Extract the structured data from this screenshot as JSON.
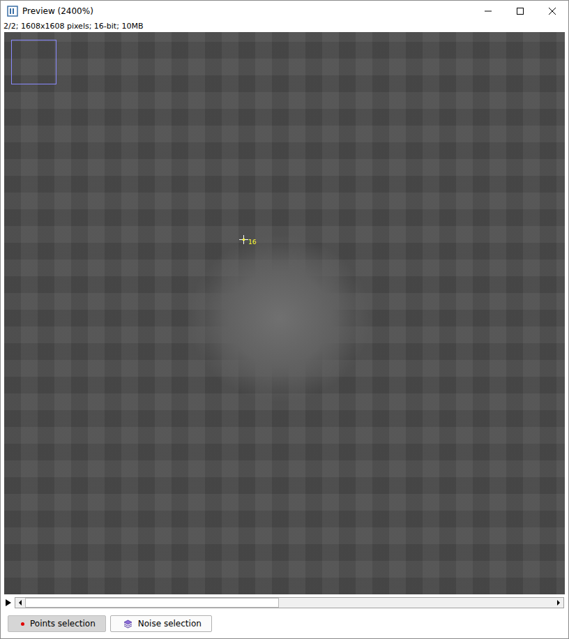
{
  "window": {
    "title": "Preview (2400%)"
  },
  "info": "2/2; 1608x1608 pixels; 16-bit; 10MB",
  "image": {
    "cursor_label": "16"
  },
  "scrollbar": {
    "level": 0.48
  },
  "buttons": [
    {
      "label": "Points selection",
      "selected": true,
      "kind": "points"
    },
    {
      "label": "Noise selection",
      "selected": false,
      "kind": "noise"
    }
  ]
}
